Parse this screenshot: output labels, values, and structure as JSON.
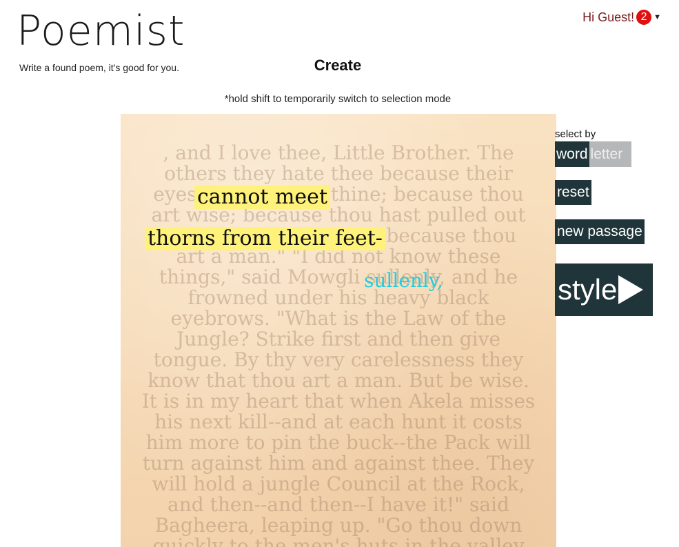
{
  "header": {
    "logo": "Poemist",
    "tagline": "Write a found poem, it's good for you.",
    "page_title": "Create",
    "greeting": "Hi Guest!",
    "notification_count": "2"
  },
  "hint": "*hold shift to temporarily switch to selection mode",
  "passage": {
    "lines": [
      ", and I love thee, Little Brother. The",
      "others they hate thee because their",
      "eyes cannot meet thine; because thou",
      "art wise; because thou hast pulled out",
      "thorns from their feet--because thou",
      "art a man.\" \"I did not know these",
      "things,\" said Mowgli sullenly, and he",
      "frowned under his heavy black",
      "eyebrows. \"What is the Law of the",
      "Jungle? Strike first and then give",
      "tongue. By thy very carelessness they",
      "know that thou art a man. But be wise.",
      "It is in my heart that when Akela misses",
      "his next kill--and at each hunt it costs",
      "him more to pin the buck--the Pack will",
      "turn against him and against thee. They",
      "will hold a jungle Council at the Rock,",
      "and then--and then--I have it!\" said",
      "Bagheera, leaping up. \"Go thou down",
      "quickly to the men's huts in the valley"
    ],
    "selections": [
      {
        "text": "cannot meet",
        "style": "highlight"
      },
      {
        "text": "thorns from their feet-",
        "style": "highlight"
      },
      {
        "text": "sullenly,",
        "style": "cyan"
      }
    ]
  },
  "controls": {
    "select_by_label": "select by",
    "mode_word": "word",
    "mode_letter": "letter",
    "reset": "reset",
    "new_passage": "new passage",
    "style": "style"
  },
  "colors": {
    "button_bg": "#1f3539",
    "highlight": "#fff27a",
    "cyan_text": "#1ecfe0",
    "badge": "#e01010"
  }
}
